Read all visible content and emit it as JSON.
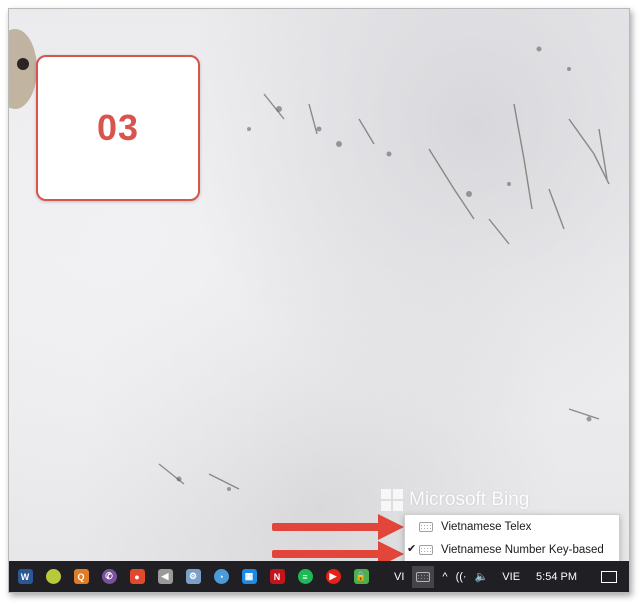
{
  "step_number": "03",
  "watermark": "Microsoft Bing",
  "ime_menu": {
    "items": [
      {
        "label": "Vietnamese Telex",
        "checked": false
      },
      {
        "label": "Vietnamese Number Key-based",
        "checked": true
      }
    ],
    "check_glyph": "✔"
  },
  "taskbar": {
    "apps": [
      {
        "name": "word-icon",
        "glyph": "W",
        "color": "#2b5797"
      },
      {
        "name": "smiley-app-icon",
        "glyph": "",
        "color": "#b8c93a"
      },
      {
        "name": "orange-app-icon",
        "glyph": "Q",
        "color": "#e07b28"
      },
      {
        "name": "viber-icon",
        "glyph": "✆",
        "color": "#7b519d"
      },
      {
        "name": "maps-pin-icon",
        "glyph": "●",
        "color": "#e0492e"
      },
      {
        "name": "audio-app-icon",
        "glyph": "◀",
        "color": "#9a9a9a"
      },
      {
        "name": "settings-app-icon",
        "glyph": "⚙",
        "color": "#7aa0c8"
      },
      {
        "name": "speedometer-icon",
        "glyph": "◔",
        "color": "#4b9bd8"
      },
      {
        "name": "calendar-icon",
        "glyph": "▦",
        "color": "#1e88e5"
      },
      {
        "name": "netflix-icon",
        "glyph": "N",
        "color": "#c4141b"
      },
      {
        "name": "spotify-icon",
        "glyph": "≡",
        "color": "#1db954"
      },
      {
        "name": "youtube-icon",
        "glyph": "▶",
        "color": "#e62117"
      },
      {
        "name": "lock-app-icon",
        "glyph": "🔒",
        "color": "#4caf50"
      }
    ],
    "tray": {
      "lang_short": "VI",
      "chevron": "^",
      "wifi": "((·",
      "volume": "🔈",
      "language": "VIE",
      "time": "5:54 PM"
    }
  },
  "colors": {
    "accent_red": "#d9534f",
    "taskbar": "#1f1f24"
  }
}
